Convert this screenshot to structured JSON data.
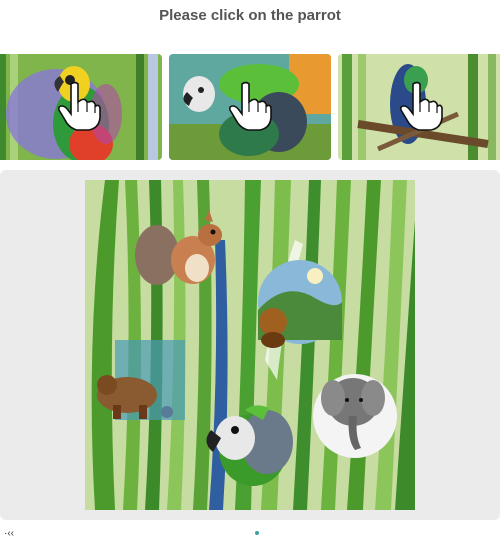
{
  "prompt": {
    "text": "Please click on the parrot"
  },
  "examples": [
    {
      "subject": "parrot",
      "icon": "pointer-hand-icon"
    },
    {
      "subject": "parrot",
      "icon": "pointer-hand-icon"
    },
    {
      "subject": "parrot",
      "icon": "pointer-hand-icon"
    }
  ],
  "challenge": {
    "animals": [
      "squirrel",
      "monkey",
      "bear",
      "elephant",
      "parrot"
    ]
  },
  "footer": {
    "left_text": "·‹‹"
  },
  "colors": {
    "prompt_text": "#555555",
    "panel_bg": "#ebebeb",
    "grass_green": "#4d9b2e",
    "accent_teal": "#3aa0a0"
  }
}
